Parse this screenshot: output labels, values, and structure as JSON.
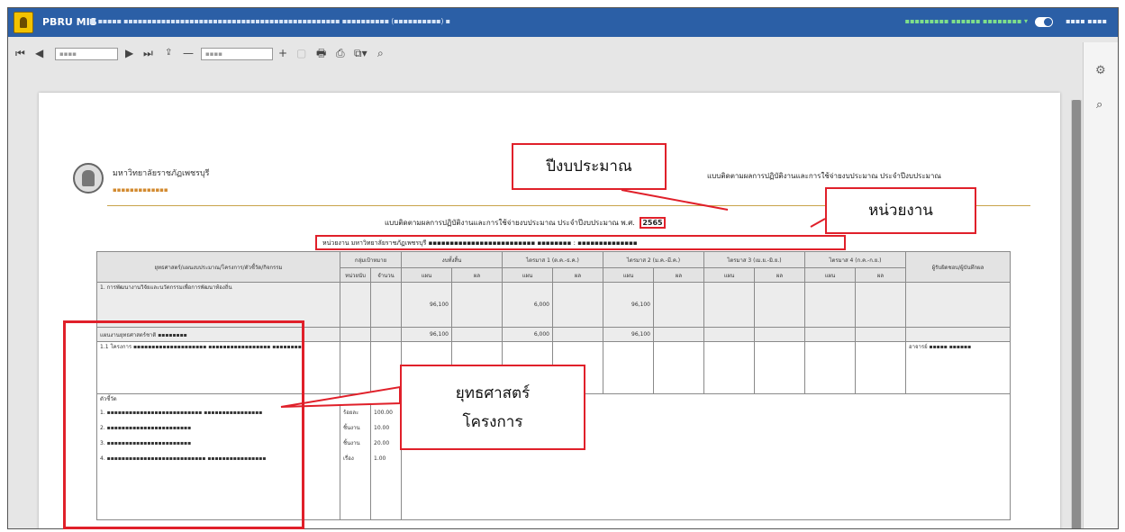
{
  "appbar": {
    "app_name": "PBRU MIS",
    "breadcrumb": "■ ▪▪▪▪▪  ▪▪▪▪▪▪▪▪▪▪▪▪▪▪▪▪▪▪▪▪▪▪▪▪▪▪▪▪▪▪▪▪▪▪▪▪▪▪▪▪▪▪▪▪▪▪ ▪▪▪▪▪▪▪▪▪▪ (▪▪▪▪▪▪▪▪▪▪) ▪",
    "user_name": "▪▪▪▪▪▪▪▪▪ ▪▪▪▪▪▪ ▪▪▪▪▪▪▪▪ ▾",
    "dark_mode_label": "▪▪▪▪ ▪▪▪▪"
  },
  "toolbar": {
    "first": "⏮",
    "prev": "◀",
    "page_value": "▪▪▪▪",
    "next": "▶",
    "last": "⏭",
    "zoom_out": "—",
    "zoom_value": "▪▪▪▪",
    "zoom_in": "+",
    "icons": [
      "search-icon"
    ]
  },
  "document": {
    "univ_name": "มหาวิทยาลัยราชภัฏเพชรบุรี",
    "univ_sub": "▪▪▪▪▪▪▪▪▪▪▪▪▪",
    "header_right": "แบบติดตามผลการปฏิบัติงานและการใช้จ่ายงบประมาณ ประจำปีงบประมาณ",
    "report_title": "แบบติดตามผลการปฏิบัติงานและการใช้จ่ายงบประมาณ ประจำปีงบประมาณ พ.ศ.",
    "year": "2565",
    "unit_line": "หน่วยงาน มหาวิทยาลัยราชภัฏเพชรบุรี ▪▪▪▪▪▪▪▪▪▪▪▪▪▪▪▪▪▪▪▪▪▪▪▪▪ ▪▪▪▪▪▪▪▪ : ▪▪▪▪▪▪▪▪▪▪▪▪▪▪",
    "table": {
      "h_strategy": "ยุทธศาสตร์/แผนงบประมาณ/โครงการ/ตัวชี้วัด/กิจกรรม",
      "h_target": "กลุ่มเป้าหมาย",
      "h_total": "งบทั้งสิ้น",
      "h_q1": "ไตรมาส 1 (ต.ค.-ธ.ค.)",
      "h_q2": "ไตรมาส 2 (ม.ค.-มี.ค.)",
      "h_q3": "ไตรมาส 3 (เม.ย.-มิ.ย.)",
      "h_q4": "ไตรมาส 4 (ก.ค.-ก.ย.)",
      "h_owner": "ผู้รับผิดชอบ/ผู้บันทึกผล",
      "sub_unit": "หน่วยนับ",
      "sub_amount": "จำนวน",
      "sub_plan": "แผน",
      "sub_actual": "ผล",
      "row1_label": "1. การพัฒนางานวิจัยและนวัตกรรมเพื่อการพัฒนาท้องถิ่น",
      "row1_total": "96,100",
      "row1_q1": "6,000",
      "row1_q2": "96,100",
      "row2_label": "แผนงานยุทธศาสตร์ชาติ ▪▪▪▪▪▪▪▪",
      "row2_total": "96,100",
      "row2_q1": "6,000",
      "row2_q2": "96,100",
      "row3_label": "1.1 โครงการ ▪▪▪▪▪▪▪▪▪▪▪▪▪▪▪▪▪▪▪▪ ▪▪▪▪▪▪▪▪▪▪▪▪▪▪▪▪▪ ▪▪▪▪▪▪▪▪",
      "row3_owner": "อาจารย์ ▪▪▪▪▪ ▪▪▪▪▪▪",
      "ind_label": "ตัวชี้วัด",
      "ind1": "1. ▪▪▪▪▪▪▪▪▪▪▪▪▪▪▪▪▪▪▪▪▪▪▪▪▪▪ ▪▪▪▪▪▪▪▪▪▪▪▪▪▪▪▪",
      "ind1_unit": "ร้อยละ",
      "ind1_amt": "100.00",
      "ind2": "2. ▪▪▪▪▪▪▪▪▪▪▪▪▪▪▪▪▪▪▪▪▪▪▪",
      "ind2_unit": "ชิ้นงาน",
      "ind2_amt": "10.00",
      "ind3": "3. ▪▪▪▪▪▪▪▪▪▪▪▪▪▪▪▪▪▪▪▪▪▪▪",
      "ind3_unit": "ชิ้นงาน",
      "ind3_amt": "20.00",
      "ind4": "4. ▪▪▪▪▪▪▪▪▪▪▪▪▪▪▪▪▪▪▪▪▪▪▪▪▪▪▪ ▪▪▪▪▪▪▪▪▪▪▪▪▪▪▪▪",
      "ind4_unit": "เรื่อง",
      "ind4_amt": "1.00"
    }
  },
  "callouts": {
    "year": "ปีงบประมาณ",
    "unit": "หน่วยงาน",
    "strategy_line1": "ยุทธศาสตร์",
    "strategy_line2": "โครงการ"
  },
  "colors": {
    "appbar": "#2b5fa6",
    "highlight": "#e0202a"
  }
}
